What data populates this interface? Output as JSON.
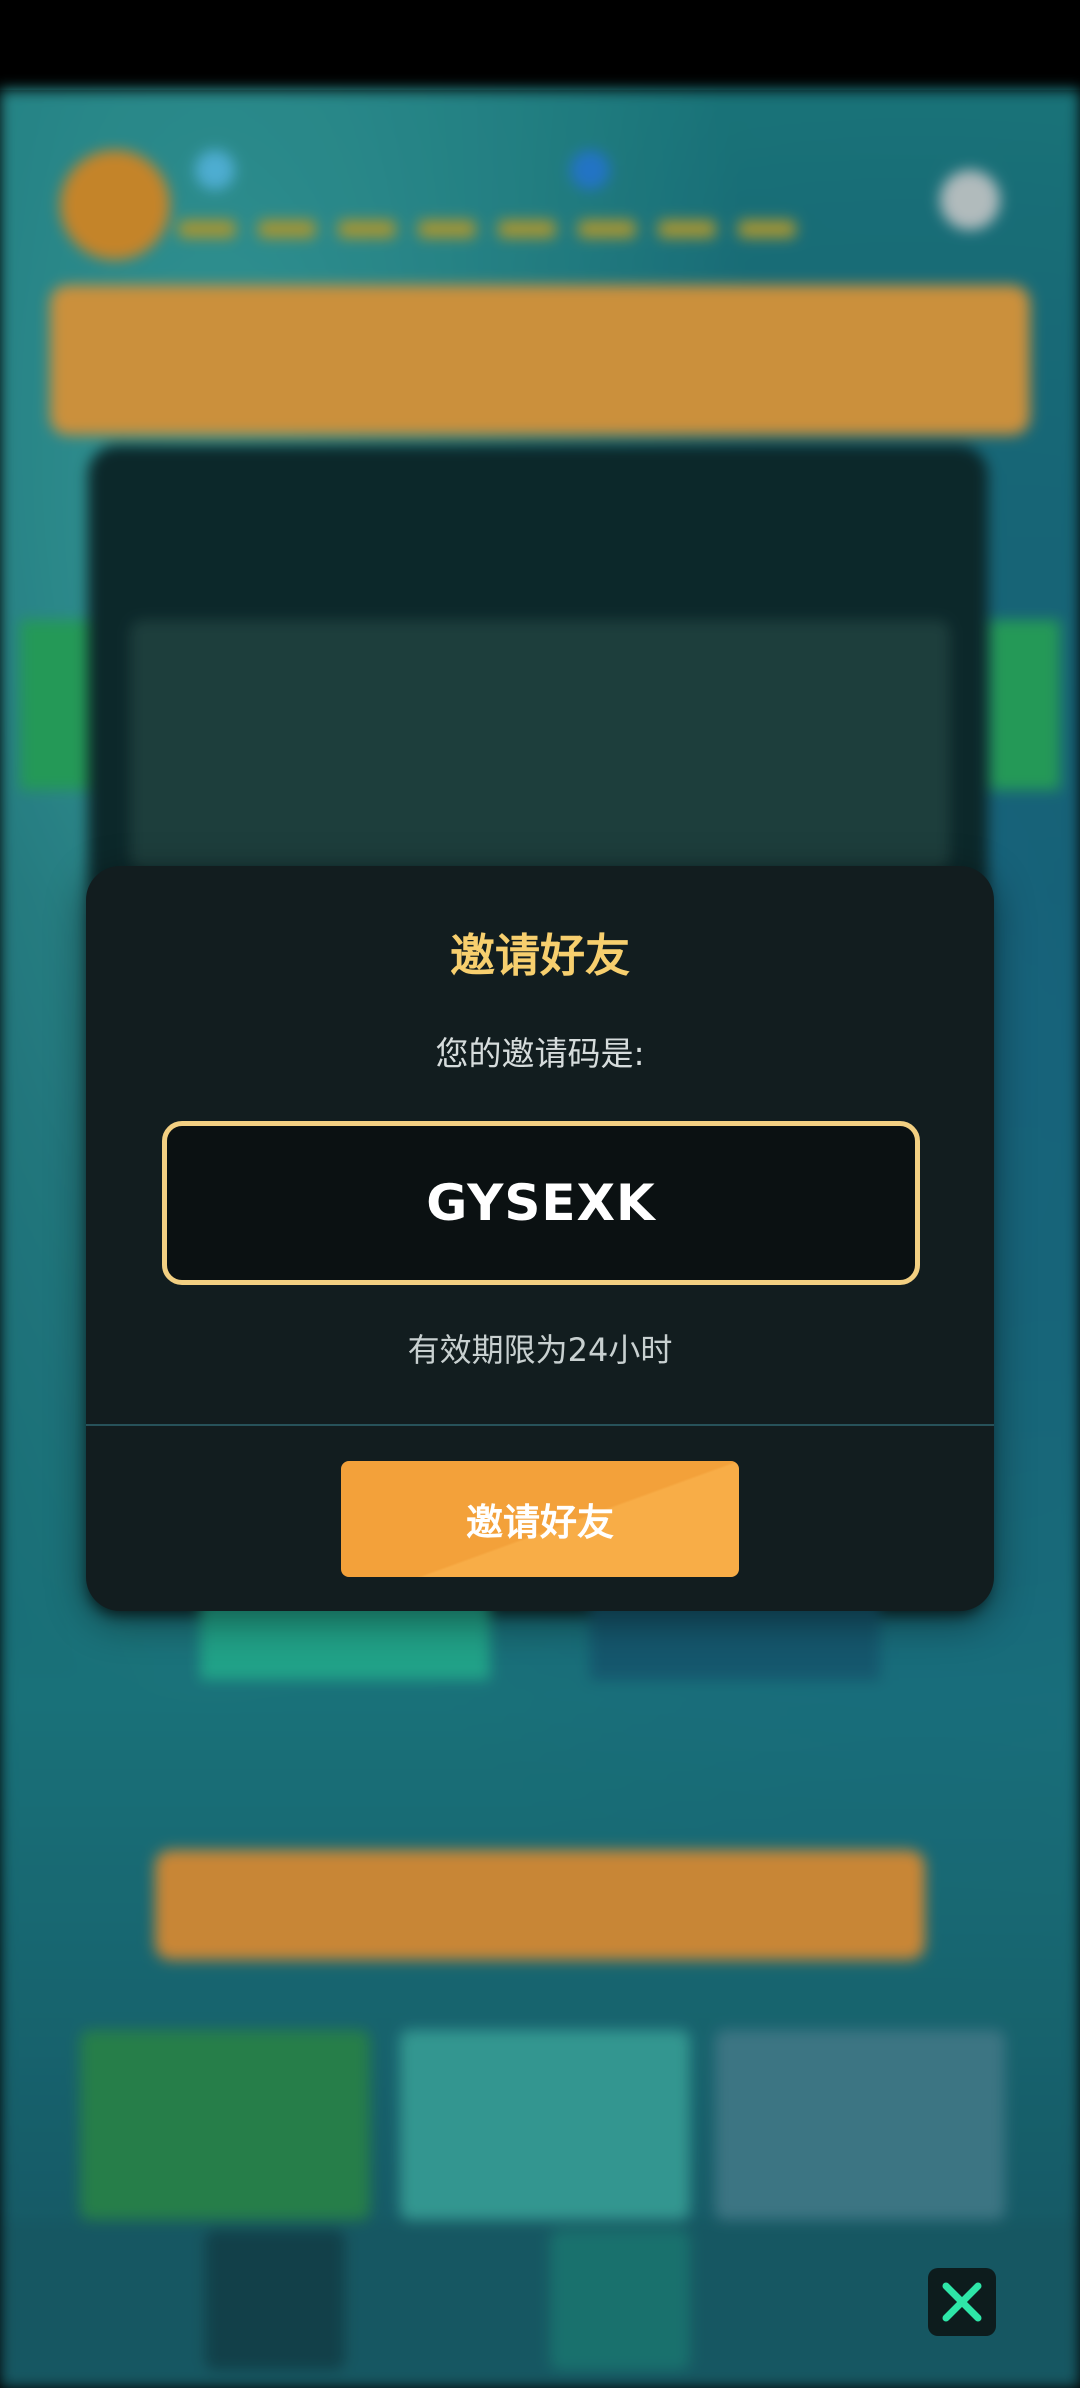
{
  "modal": {
    "title": "邀请好友",
    "subtitle": "您的邀请码是:",
    "invite_code": "GYSEXK",
    "validity_note": "有效期限为24小时",
    "invite_button_label": "邀请好友"
  },
  "close_button": {
    "icon": "close-icon"
  },
  "colors": {
    "modal_bg": "#121d1f",
    "title_gold": "#f7cf6e",
    "code_border": "#f3d082",
    "button_orange": "#f3a13a",
    "close_green": "#2ee6a8"
  }
}
